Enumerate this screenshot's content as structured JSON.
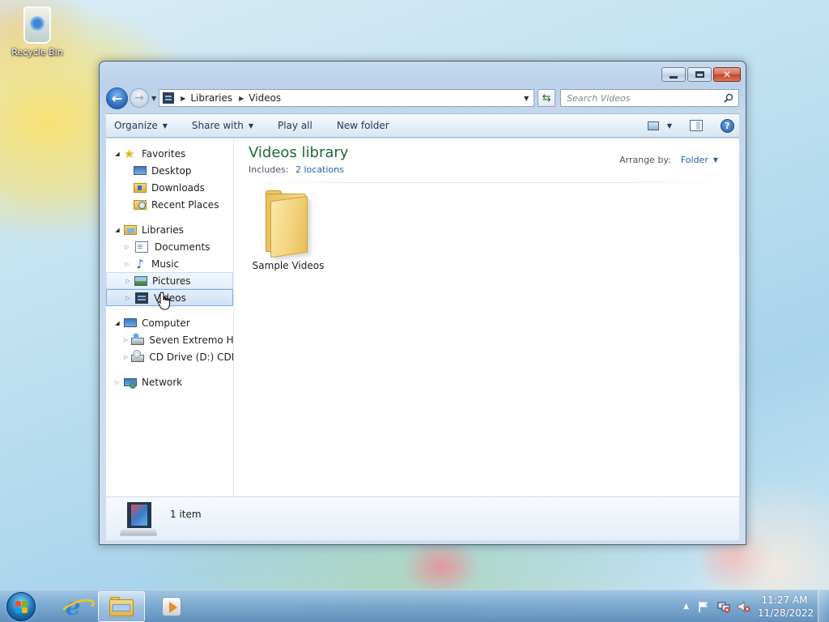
{
  "desktop": {
    "icons": [
      {
        "label": "Recycle Bin",
        "icon": "recycle-bin-icon"
      }
    ]
  },
  "window": {
    "controls": {
      "minimize": "minimize",
      "maximize": "maximize",
      "close": "✕"
    },
    "nav": {
      "back_glyph": "←",
      "forward_glyph": "→",
      "breadcrumbs": [
        "Libraries",
        "Videos"
      ]
    },
    "search": {
      "placeholder": "Search Videos",
      "value": ""
    },
    "toolbar": {
      "organize_label": "Organize",
      "share_label": "Share with",
      "play_all_label": "Play all",
      "new_folder_label": "New folder",
      "help_glyph": "?"
    },
    "navpane": {
      "favorites": {
        "label": "Favorites",
        "items": [
          {
            "label": "Desktop",
            "icon": "desktop-icon"
          },
          {
            "label": "Downloads",
            "icon": "downloads-icon"
          },
          {
            "label": "Recent Places",
            "icon": "recent-places-icon"
          }
        ]
      },
      "libraries": {
        "label": "Libraries",
        "items": [
          {
            "label": "Documents",
            "icon": "documents-icon"
          },
          {
            "label": "Music",
            "icon": "music-icon"
          },
          {
            "label": "Pictures",
            "icon": "pictures-icon",
            "state": "hover"
          },
          {
            "label": "Videos",
            "icon": "videos-icon",
            "state": "selected"
          }
        ]
      },
      "computer": {
        "label": "Computer",
        "items": [
          {
            "label": "Seven Extremo HD (C:)",
            "icon": "hard-drive-icon"
          },
          {
            "label": "CD Drive (D:) CDROM",
            "icon": "cd-drive-icon"
          }
        ]
      },
      "network": {
        "label": "Network"
      }
    },
    "library": {
      "title": "Videos library",
      "includes_label": "Includes:",
      "locations_link": "2 locations",
      "arrange_label": "Arrange by:",
      "arrange_value": "Folder",
      "items": [
        {
          "label": "Sample Videos",
          "icon": "folder-icon"
        }
      ]
    },
    "details": {
      "count": "1 item"
    }
  },
  "taskbar": {
    "pinned": [
      {
        "name": "internet-explorer",
        "icon": "internet-explorer-icon",
        "active": false
      },
      {
        "name": "windows-explorer",
        "icon": "folder-icon",
        "active": true
      },
      {
        "name": "media-player",
        "icon": "media-player-icon",
        "active": false
      }
    ],
    "tray": {
      "show_hidden_glyph": "▲",
      "time": "11:27 AM",
      "date": "11/28/2022"
    }
  },
  "colors": {
    "library_title": "#1e6a34",
    "link": "#2260b0",
    "selection_border": "#84acdd"
  }
}
